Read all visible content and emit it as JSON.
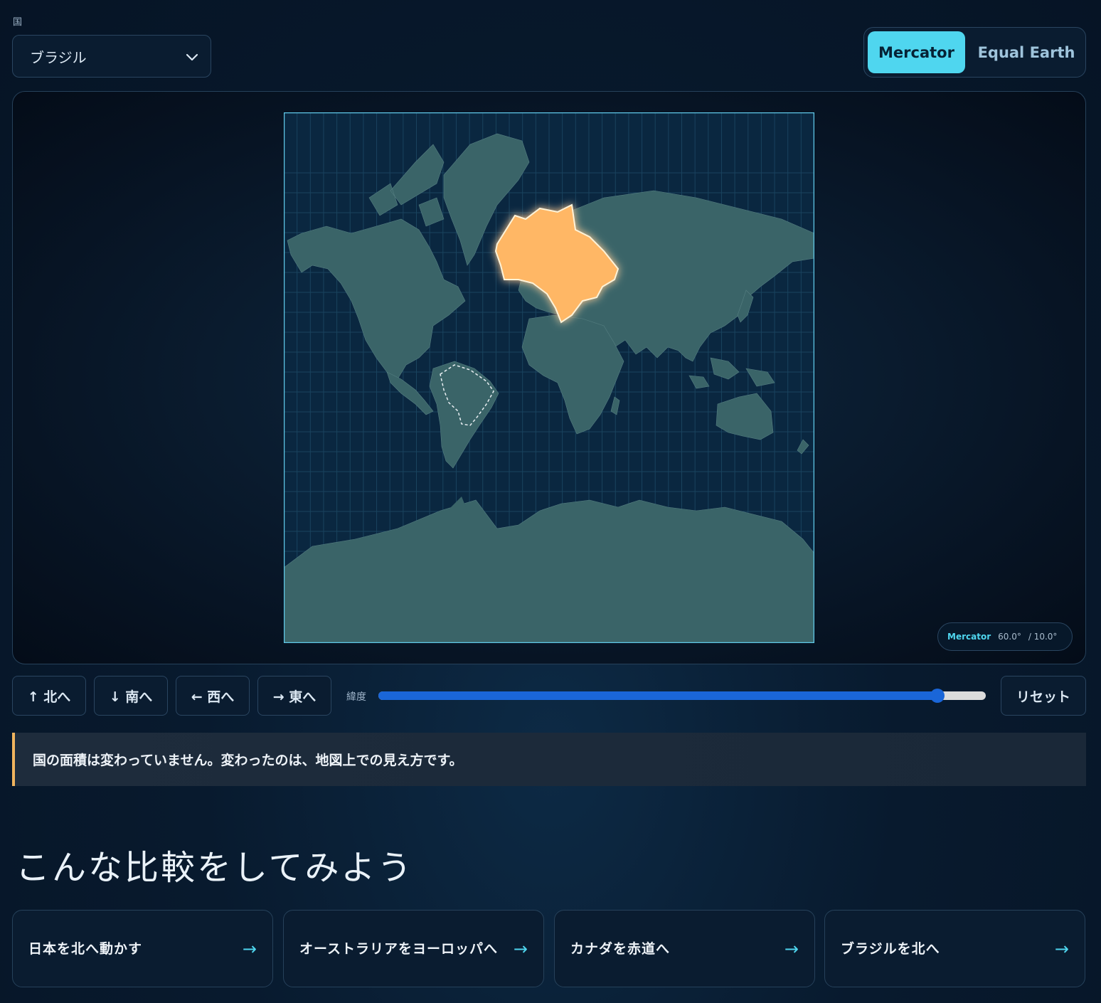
{
  "country_selector": {
    "label": "国",
    "value": "ブラジル"
  },
  "projection_toggle": {
    "options": [
      "Mercator",
      "Equal Earth"
    ],
    "active": "Mercator"
  },
  "map": {
    "highlight_country": "ブラジル",
    "colors": {
      "land": "#3a6468",
      "ocean": "#0a2740",
      "highlight": "#ffb765",
      "frame": "#5fc8e8"
    },
    "badge": {
      "projection": "Mercator",
      "lat": "60.0°",
      "lon": "/ 10.0°"
    }
  },
  "controls": {
    "north": "↑ 北へ",
    "south": "↓ 南へ",
    "west": "← 西へ",
    "east": "→ 東へ",
    "latitude_label": "緯度",
    "latitude_fraction": 0.92,
    "reset": "リセット"
  },
  "notice": "国の面積は変わっていません。変わったのは、地図上での見え方です。",
  "comparisons": {
    "title": "こんな比較をしてみよう",
    "cards": [
      {
        "label": "日本を北へ動かす",
        "arrow": "→"
      },
      {
        "label": "オーストラリアをヨーロッパへ",
        "arrow": "→"
      },
      {
        "label": "カナダを赤道へ",
        "arrow": "→"
      },
      {
        "label": "ブラジルを北へ",
        "arrow": "→"
      }
    ]
  }
}
